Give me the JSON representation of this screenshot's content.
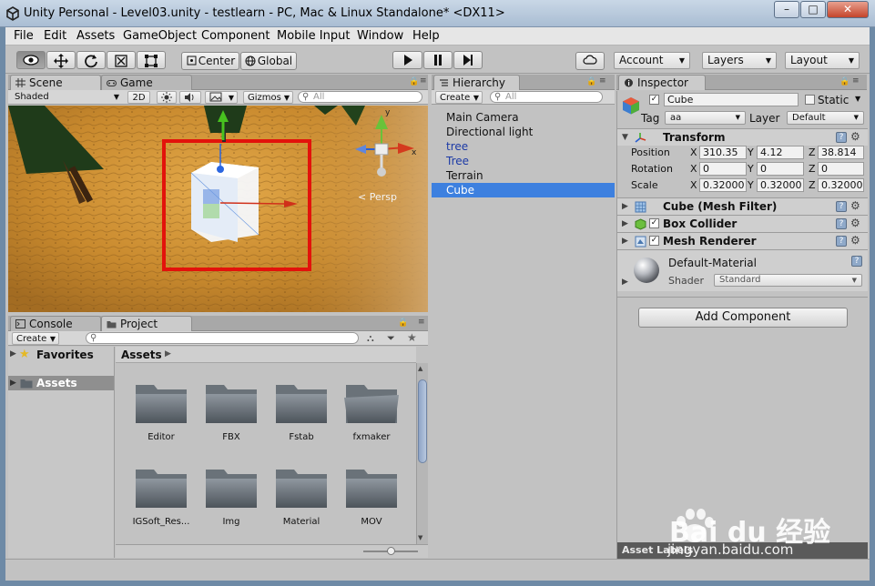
{
  "window": {
    "title": "Unity Personal - Level03.unity - testlearn - PC, Mac & Linux Standalone* <DX11>",
    "minimize": "–",
    "maximize": "□",
    "close": "✕"
  },
  "menu": [
    "File",
    "Edit",
    "Assets",
    "GameObject",
    "Component",
    "Mobile Input",
    "Window",
    "Help"
  ],
  "toolbar": {
    "pivot_center": "Center",
    "pivot_global": "Global",
    "account": "Account",
    "layers": "Layers",
    "layout": "Layout"
  },
  "scene": {
    "tab_scene": "Scene",
    "tab_game": "Game",
    "shading": "Shaded",
    "mode_2d": "2D",
    "gizmos": "Gizmos",
    "search_placeholder": "All",
    "persp_label": "< Persp",
    "axis_x": "x",
    "axis_y": "y"
  },
  "hierarchy": {
    "tab": "Hierarchy",
    "create": "Create",
    "search_placeholder": "All",
    "items": [
      {
        "label": "Main Camera",
        "color": "#111111",
        "selected": false
      },
      {
        "label": "Directional light",
        "color": "#111111",
        "selected": false
      },
      {
        "label": "tree",
        "color": "#1c3aa6",
        "selected": false
      },
      {
        "label": "Tree",
        "color": "#1c3aa6",
        "selected": false
      },
      {
        "label": "Terrain",
        "color": "#111111",
        "selected": false
      },
      {
        "label": "Cube",
        "color": "#ffffff",
        "selected": true
      }
    ]
  },
  "inspector": {
    "tab": "Inspector",
    "object_name": "Cube",
    "static_label": "Static",
    "tag_label": "Tag",
    "tag_value": "aa",
    "layer_label": "Layer",
    "layer_value": "Default",
    "transform": {
      "title": "Transform",
      "position_label": "Position",
      "rotation_label": "Rotation",
      "scale_label": "Scale",
      "x": "X",
      "y": "Y",
      "z": "Z",
      "position": [
        "310.35",
        "4.12",
        "38.814"
      ],
      "rotation": [
        "0",
        "0",
        "0"
      ],
      "scale": [
        "0.32000",
        "0.32000",
        "0.32000"
      ]
    },
    "components": [
      {
        "title": "Cube (Mesh Filter)"
      },
      {
        "title": "Box Collider"
      },
      {
        "title": "Mesh Renderer"
      }
    ],
    "material": {
      "name": "Default-Material",
      "shader_label": "Shader",
      "shader_value": "Standard"
    },
    "add_component": "Add Component",
    "asset_labels": "Asset Labels"
  },
  "project": {
    "tab_console": "Console",
    "tab_project": "Project",
    "create": "Create",
    "favorites": "Favorites",
    "assets_root": "Assets",
    "breadcrumb": "Assets",
    "folders": [
      "Editor",
      "FBX",
      "Fstab",
      "fxmaker",
      "IGSoft_Res...",
      "Img",
      "Material",
      "MOV"
    ]
  },
  "watermark": {
    "brand": "Bai du 经验",
    "url": "jingyan.baidu.com"
  },
  "colors": {
    "selection": "#3d80df",
    "highlight_box": "#e3120b",
    "terrain": "#c98a2e"
  }
}
